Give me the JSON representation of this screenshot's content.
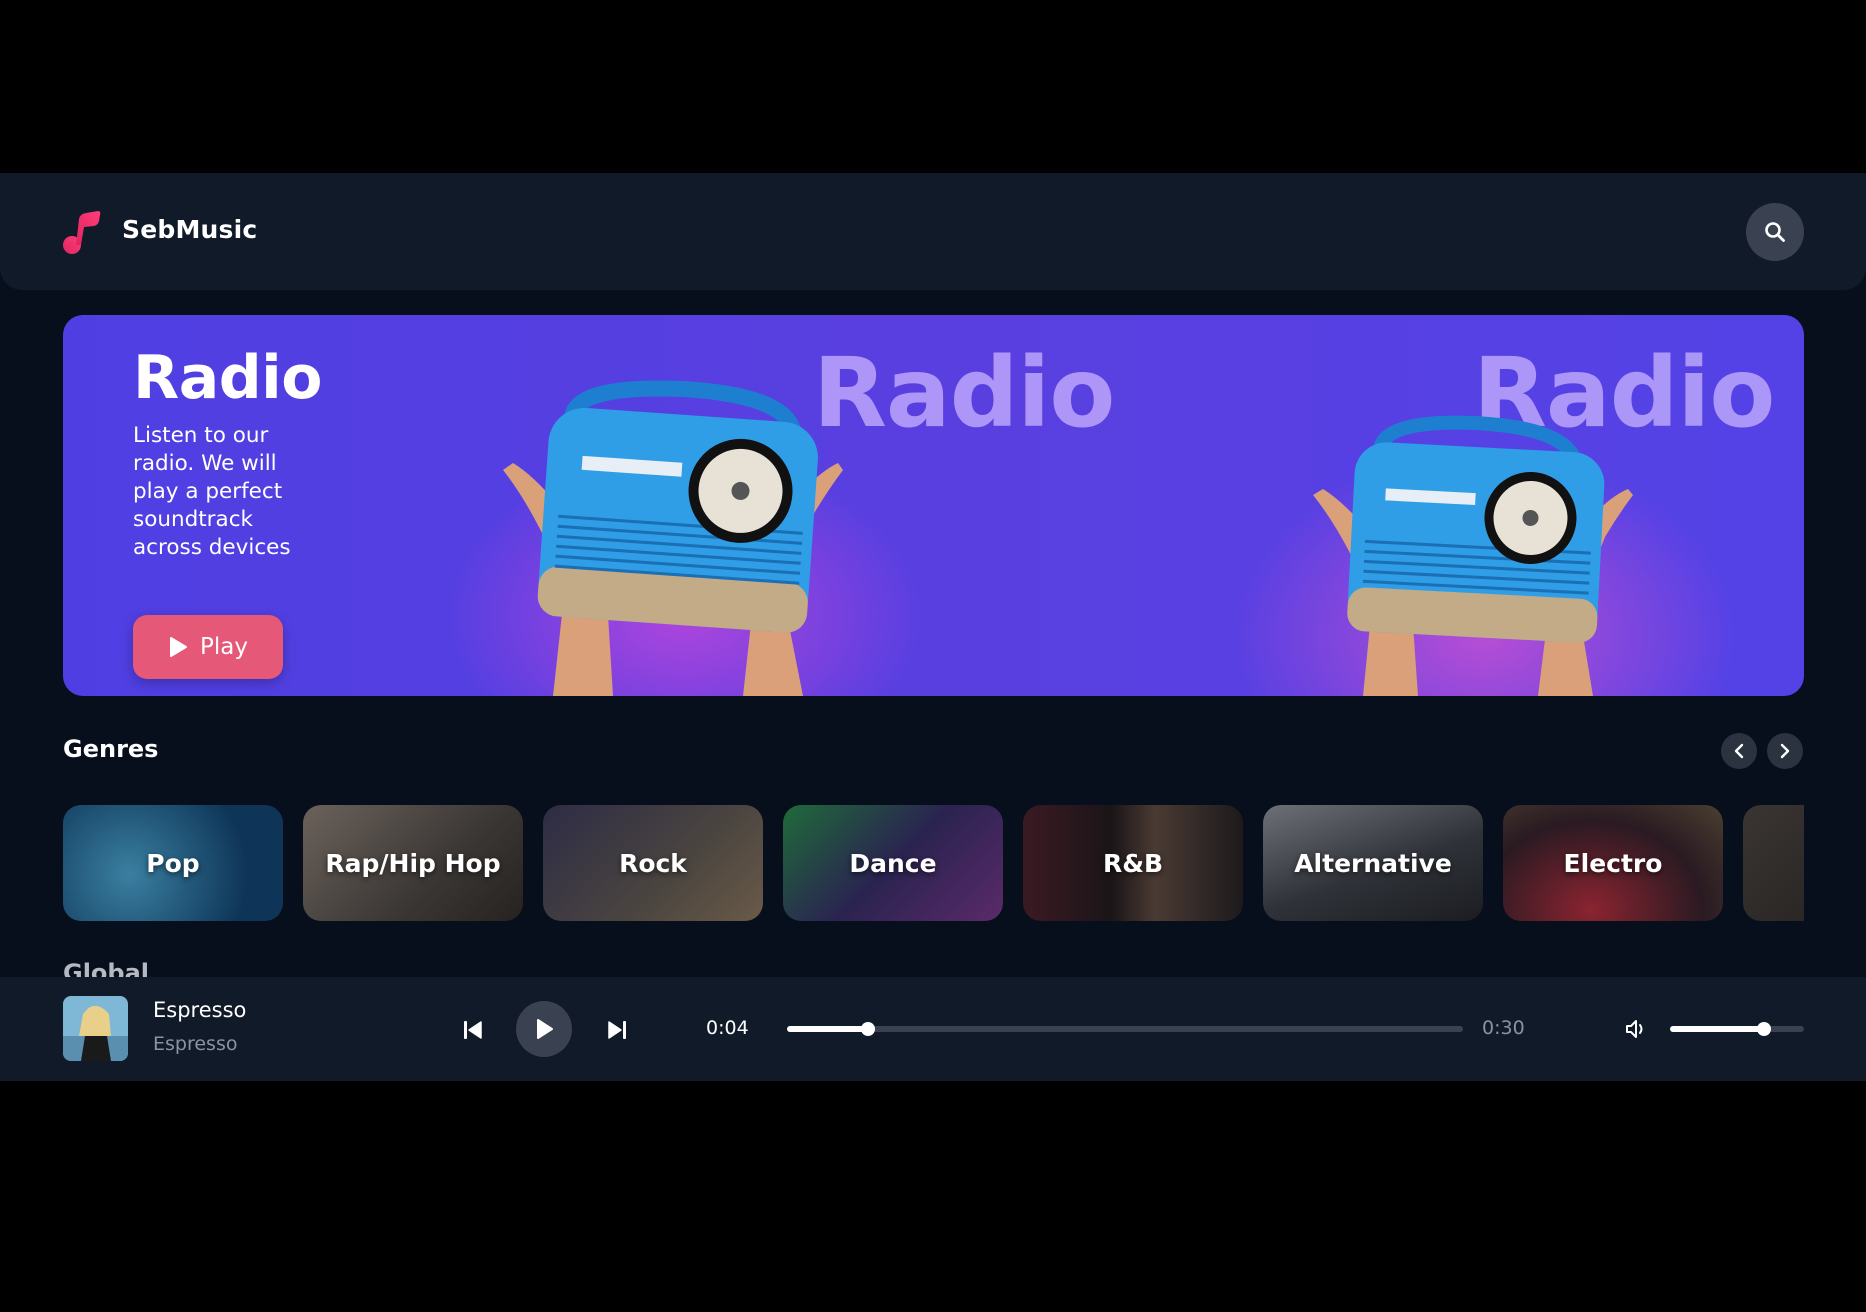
{
  "app": {
    "name": "SebMusic"
  },
  "hero": {
    "title": "Radio",
    "description": "Listen to our radio. We will play a perfect soundtrack across devices",
    "play_label": "Play",
    "ghost_text": "Radio"
  },
  "genres": {
    "title": "Genres",
    "items": [
      {
        "label": "Pop"
      },
      {
        "label": "Rap/Hip Hop"
      },
      {
        "label": "Rock"
      },
      {
        "label": "Dance"
      },
      {
        "label": "R&B"
      },
      {
        "label": "Alternative"
      },
      {
        "label": "Electro"
      }
    ]
  },
  "global": {
    "title": "Global"
  },
  "player": {
    "track_title": "Espresso",
    "artist": "Espresso",
    "elapsed": "0:04",
    "duration": "0:30",
    "progress": 0.12,
    "volume": 0.7
  },
  "icons": {
    "logo": "music-note-icon",
    "search": "search-icon",
    "prev": "skip-previous-icon",
    "play": "play-icon",
    "next": "skip-next-icon",
    "volume": "volume-icon",
    "chevron_left": "chevron-left-icon",
    "chevron_right": "chevron-right-icon"
  },
  "colors": {
    "background": "#070e1c",
    "panel": "#111a29",
    "accent": "#e55878",
    "hero": "#4f3fe3"
  }
}
